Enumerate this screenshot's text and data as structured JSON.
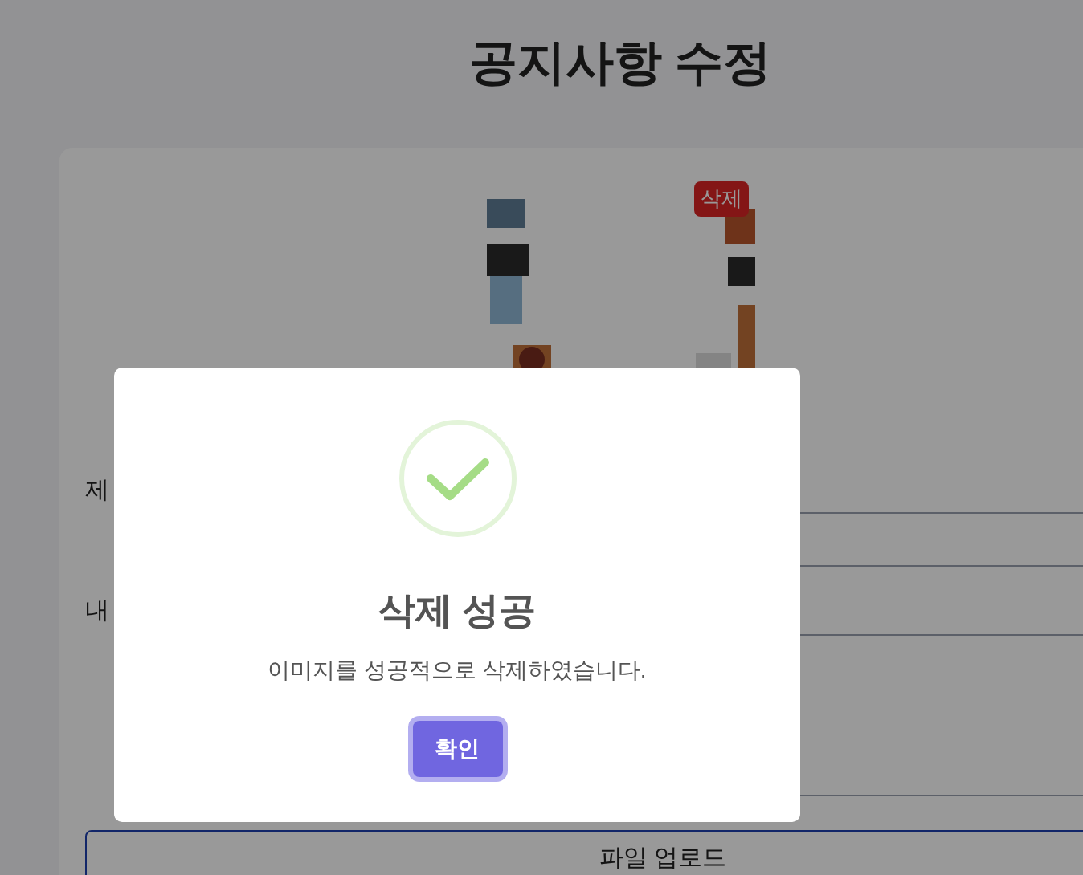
{
  "page": {
    "title": "공지사항 수정"
  },
  "form": {
    "image": {
      "kind": "picture",
      "delete_button": "삭제"
    },
    "fields": [
      {
        "label": "제",
        "kind": "input"
      },
      {
        "label": "내",
        "kind": "textarea"
      }
    ],
    "upload_button": "파일 업로드"
  },
  "dialog": {
    "kind": "success",
    "title": "삭제 성공",
    "message": "이미지를 성공적으로 삭제하였습니다.",
    "confirm_button": "확인"
  }
}
